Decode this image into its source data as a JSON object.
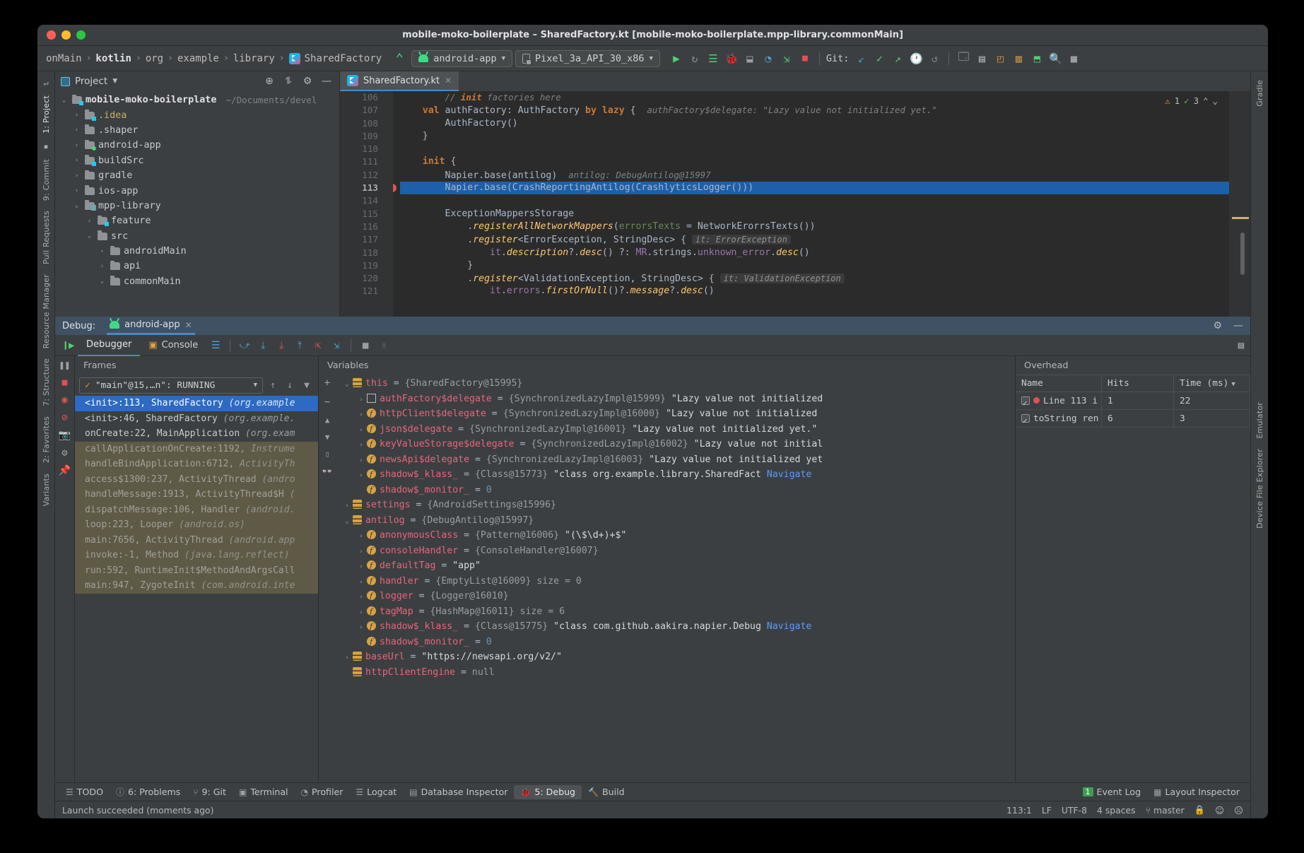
{
  "window": {
    "title": "mobile-moko-boilerplate – SharedFactory.kt [mobile-moko-boilerplate.mpp-library.commonMain]"
  },
  "navbar": {
    "breadcrumbs": [
      "onMain",
      "kotlin",
      "org",
      "example",
      "library",
      "SharedFactory"
    ],
    "module_config": "android-app",
    "device_config": "Pixel_3a_API_30_x86",
    "git_label": "Git:"
  },
  "project_panel": {
    "title": "Project",
    "root": {
      "label": "mobile-moko-boilerplate",
      "path": "~/Documents/devel"
    },
    "items": [
      {
        "label": ".idea",
        "indent": 1,
        "twisty": "›",
        "icon": "folder-blue",
        "yellow": true
      },
      {
        "label": ".shaper",
        "indent": 1,
        "twisty": "›",
        "icon": "folder"
      },
      {
        "label": "android-app",
        "indent": 1,
        "twisty": "›",
        "icon": "folder-green"
      },
      {
        "label": "buildSrc",
        "indent": 1,
        "twisty": "›",
        "icon": "folder-blue"
      },
      {
        "label": "gradle",
        "indent": 1,
        "twisty": "›",
        "icon": "folder"
      },
      {
        "label": "ios-app",
        "indent": 1,
        "twisty": "›",
        "icon": "folder"
      },
      {
        "label": "mpp-library",
        "indent": 1,
        "twisty": "⌄",
        "icon": "folder-bars"
      },
      {
        "label": "feature",
        "indent": 2,
        "twisty": "›",
        "icon": "folder-blue"
      },
      {
        "label": "src",
        "indent": 2,
        "twisty": "⌄",
        "icon": "folder"
      },
      {
        "label": "androidMain",
        "indent": 3,
        "twisty": "›",
        "icon": "folder"
      },
      {
        "label": "api",
        "indent": 3,
        "twisty": "›",
        "icon": "folder"
      },
      {
        "label": "commonMain",
        "indent": 3,
        "twisty": "⌄",
        "icon": "folder"
      }
    ]
  },
  "editor": {
    "tab_label": "SharedFactory.kt",
    "inspection": {
      "warnings": "1",
      "checks": "3"
    },
    "lines": [
      {
        "n": "106",
        "text": "        // init factories here",
        "cls": "comment"
      },
      {
        "n": "107",
        "text": "    val authFactory: AuthFactory by lazy {",
        "hint": "authFactory$delegate: \"Lazy value not initialized yet.\""
      },
      {
        "n": "108",
        "text": "        AuthFactory()"
      },
      {
        "n": "109",
        "text": "    }"
      },
      {
        "n": "110",
        "text": ""
      },
      {
        "n": "111",
        "text": "    init {"
      },
      {
        "n": "112",
        "text": "        Napier.base(antilog)",
        "hint": "antilog: DebugAntilog@15997"
      },
      {
        "n": "113",
        "text": "        Napier.base(CrashReportingAntilog(CrashlyticsLogger()))",
        "highlight": true,
        "breakpoint": true
      },
      {
        "n": "114",
        "text": ""
      },
      {
        "n": "115",
        "text": "        ExceptionMappersStorage"
      },
      {
        "n": "116",
        "text": "            .registerAllNetworkMappers(errorsTexts = NetworkErorrsTexts())"
      },
      {
        "n": "117",
        "text": "            .register<ErrorException, StringDesc> {",
        "inlay": "it: ErrorException"
      },
      {
        "n": "118",
        "text": "                it.description?.desc() ?: MR.strings.unknown_error.desc()"
      },
      {
        "n": "119",
        "text": "            }"
      },
      {
        "n": "120",
        "text": "            .register<ValidationException, StringDesc> {",
        "inlay": "it: ValidationException"
      },
      {
        "n": "121",
        "text": "                it.errors.firstOrNull()?.message?.desc()"
      }
    ]
  },
  "debug": {
    "header_label": "Debug:",
    "session_tab": "android-app",
    "tabs": [
      {
        "label": "Debugger",
        "active": true
      },
      {
        "label": "Console",
        "active": false
      }
    ],
    "frames": {
      "title": "Frames",
      "thread": "\"main\"@15,…n\": RUNNING",
      "items": [
        {
          "text": "<init>:113, SharedFactory ",
          "pkg": "(org.example",
          "state": "selected"
        },
        {
          "text": "<init>:46, SharedFactory ",
          "pkg": "(org.example.",
          "state": "app"
        },
        {
          "text": "onCreate:22, MainApplication ",
          "pkg": "(org.exam",
          "state": "app"
        },
        {
          "text": "callApplicationOnCreate:1192, ",
          "pkg": "Instrume",
          "state": "lib"
        },
        {
          "text": "handleBindApplication:6712, ",
          "pkg": "ActivityTh",
          "state": "lib"
        },
        {
          "text": "access$1300:237, ActivityThread ",
          "pkg": "(andro",
          "state": "lib"
        },
        {
          "text": "handleMessage:1913, ActivityThread$H ",
          "pkg": "(",
          "state": "lib"
        },
        {
          "text": "dispatchMessage:106, Handler ",
          "pkg": "(android.",
          "state": "lib"
        },
        {
          "text": "loop:223, Looper ",
          "pkg": "(android.os)",
          "state": "lib"
        },
        {
          "text": "main:7656, ActivityThread ",
          "pkg": "(android.app",
          "state": "lib"
        },
        {
          "text": "invoke:-1, Method ",
          "pkg": "(java.lang.reflect)",
          "state": "lib"
        },
        {
          "text": "run:592, RuntimeInit$MethodAndArgsCall",
          "pkg": "",
          "state": "lib"
        },
        {
          "text": "main:947, ZygoteInit ",
          "pkg": "(com.android.inte",
          "state": "lib"
        }
      ]
    },
    "variables": {
      "title": "Variables",
      "rows": [
        {
          "indent": 0,
          "twisty": "⌄",
          "icon": "obj",
          "name": "this",
          "eq": " = ",
          "value": "{SharedFactory@15995}"
        },
        {
          "indent": 1,
          "twisty": "›",
          "icon": "flag",
          "name": "authFactory$delegate",
          "eq": " = ",
          "value": "{SynchronizedLazyImpl@15999} ",
          "str": "\"Lazy value not initialized"
        },
        {
          "indent": 1,
          "twisty": "›",
          "icon": "f",
          "name": "httpClient$delegate",
          "eq": " = ",
          "value": "{SynchronizedLazyImpl@16000} ",
          "str": "\"Lazy value not initialized"
        },
        {
          "indent": 1,
          "twisty": "›",
          "icon": "f",
          "name": "json$delegate",
          "eq": " = ",
          "value": "{SynchronizedLazyImpl@16001} ",
          "str": "\"Lazy value not initialized yet.\""
        },
        {
          "indent": 1,
          "twisty": "›",
          "icon": "f",
          "name": "keyValueStorage$delegate",
          "eq": " = ",
          "value": "{SynchronizedLazyImpl@16002} ",
          "str": "\"Lazy value not initial"
        },
        {
          "indent": 1,
          "twisty": "›",
          "icon": "f",
          "name": "newsApi$delegate",
          "eq": " = ",
          "value": "{SynchronizedLazyImpl@16003} ",
          "str": "\"Lazy value not initialized yet"
        },
        {
          "indent": 1,
          "twisty": "›",
          "icon": "f",
          "name": "shadow$_klass_",
          "eq": " = ",
          "value": "{Class@15773} ",
          "str": "\"class org.example.library.SharedFact",
          "nav": "Navigate"
        },
        {
          "indent": 1,
          "twisty": "",
          "icon": "f",
          "name": "shadow$_monitor_",
          "eq": " = ",
          "num": "0"
        },
        {
          "indent": 0,
          "twisty": "›",
          "icon": "obj",
          "name": "settings",
          "eq": " = ",
          "value": "{AndroidSettings@15996}"
        },
        {
          "indent": 0,
          "twisty": "⌄",
          "icon": "obj",
          "name": "antilog",
          "eq": " = ",
          "value": "{DebugAntilog@15997}"
        },
        {
          "indent": 1,
          "twisty": "›",
          "icon": "f",
          "name": "anonymousClass",
          "eq": " = ",
          "value": "{Pattern@16006} ",
          "str": "\"(\\$\\d+)+$\""
        },
        {
          "indent": 1,
          "twisty": "›",
          "icon": "f",
          "name": "consoleHandler",
          "eq": " = ",
          "value": "{ConsoleHandler@16007}"
        },
        {
          "indent": 1,
          "twisty": "›",
          "icon": "f",
          "name": "defaultTag",
          "eq": " = ",
          "str": "\"app\""
        },
        {
          "indent": 1,
          "twisty": "›",
          "icon": "f",
          "name": "handler",
          "eq": " = ",
          "value": "{EmptyList@16009}   size = 0"
        },
        {
          "indent": 1,
          "twisty": "›",
          "icon": "f",
          "name": "logger",
          "eq": " = ",
          "value": "{Logger@16010}"
        },
        {
          "indent": 1,
          "twisty": "›",
          "icon": "f",
          "name": "tagMap",
          "eq": " = ",
          "value": "{HashMap@16011}   size = 6"
        },
        {
          "indent": 1,
          "twisty": "›",
          "icon": "f",
          "name": "shadow$_klass_",
          "eq": " = ",
          "value": "{Class@15775} ",
          "str": "\"class com.github.aakira.napier.Debug",
          "nav": "Navigate"
        },
        {
          "indent": 1,
          "twisty": "",
          "icon": "f",
          "name": "shadow$_monitor_",
          "eq": " = ",
          "num": "0"
        },
        {
          "indent": 0,
          "twisty": "›",
          "icon": "obj",
          "name": "baseUrl",
          "eq": " = ",
          "str": "\"https://newsapi.org/v2/\""
        },
        {
          "indent": 0,
          "twisty": "",
          "icon": "obj",
          "name": "httpClientEngine",
          "eq": " = ",
          "value": "null"
        }
      ]
    },
    "overhead": {
      "title": "Overhead",
      "columns": [
        "Name",
        "Hits",
        "Time (ms)"
      ],
      "rows": [
        {
          "name": "Line 113 i",
          "hits": "1",
          "time": "22",
          "checked": true,
          "bp": true
        },
        {
          "name": "toString ren",
          "hits": "6",
          "time": "3",
          "checked": true,
          "bp": false
        }
      ]
    }
  },
  "bottom_bar": {
    "buttons": [
      {
        "label": "TODO",
        "icon": "list-icon",
        "active": false
      },
      {
        "label": "6: Problems",
        "icon": "info-icon",
        "active": false
      },
      {
        "label": "9: Git",
        "icon": "branch-icon",
        "active": false
      },
      {
        "label": "Terminal",
        "icon": "terminal-icon",
        "active": false
      },
      {
        "label": "Profiler",
        "icon": "profiler-icon",
        "active": false
      },
      {
        "label": "Logcat",
        "icon": "logcat-icon",
        "active": false
      },
      {
        "label": "Database Inspector",
        "icon": "database-icon",
        "active": false
      },
      {
        "label": "5: Debug",
        "icon": "bug-icon",
        "active": true
      },
      {
        "label": "Build",
        "icon": "hammer-icon",
        "active": false
      }
    ],
    "right_buttons": [
      {
        "label": "Event Log",
        "badge": "1"
      },
      {
        "label": "Layout Inspector",
        "badge": ""
      }
    ]
  },
  "status_bar": {
    "message": "Launch succeeded (moments ago)",
    "caret": "113:1",
    "line_sep": "LF",
    "encoding": "UTF-8",
    "indent": "4 spaces",
    "branch": "master"
  },
  "right_rail": {
    "items": [
      "Gradle",
      "Emulator",
      "Device File Explorer"
    ]
  },
  "left_rail": {
    "items": [
      "1: Project",
      "9: Commit",
      "Pull Requests",
      "Resource Manager",
      "7: Structure",
      "2: Favorites",
      "Variants"
    ]
  },
  "colors": {
    "accent_blue": "#4a88c7",
    "selection_blue": "#2d6ac4",
    "breakpoint_red": "#e05252",
    "android_green": "#3ddc84"
  }
}
